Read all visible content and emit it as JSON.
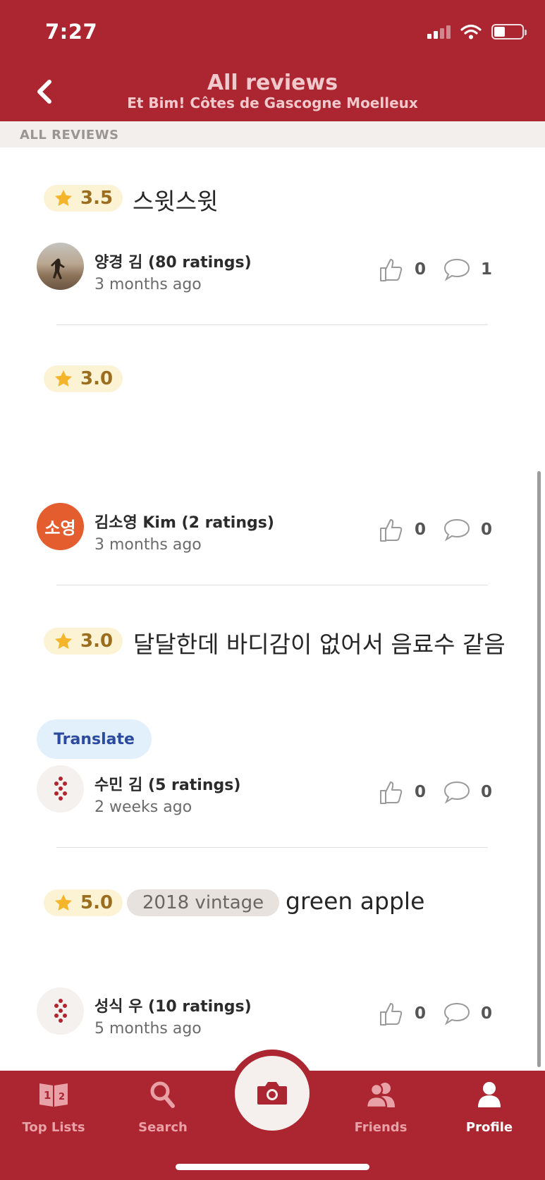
{
  "status_bar": {
    "time": "7:27"
  },
  "header": {
    "title": "All reviews",
    "subtitle": "Et Bim! Côtes de Gascogne Moelleux"
  },
  "section_label": "ALL REVIEWS",
  "reviews": [
    {
      "rating": "3.5",
      "text": "스윗스윗",
      "user": "양경 김 (80 ratings)",
      "time": "3 months ago",
      "likes": "0",
      "comments": "1"
    },
    {
      "rating": "3.0",
      "text": "",
      "user": "김소영 Kim (2 ratings)",
      "avatar_initials": "소영",
      "time": "3 months ago",
      "likes": "0",
      "comments": "0"
    },
    {
      "rating": "3.0",
      "text": "달달한데 바디감이 없어서 음료수 같음",
      "translate_label": "Translate",
      "user": "수민 김 (5 ratings)",
      "time": "2 weeks ago",
      "likes": "0",
      "comments": "0"
    },
    {
      "rating": "5.0",
      "vintage": "2018 vintage",
      "text": "green apple",
      "user": "성식 우 (10 ratings)",
      "time": "5 months ago",
      "likes": "0",
      "comments": "0"
    }
  ],
  "tabbar": {
    "tabs": [
      {
        "label": "Top Lists",
        "icon": "top-lists-icon"
      },
      {
        "label": "Search",
        "icon": "search-icon"
      },
      {
        "label": "Friends",
        "icon": "friends-icon"
      },
      {
        "label": "Profile",
        "icon": "profile-icon",
        "active": true
      }
    ],
    "center_icon": "camera-icon"
  },
  "colors": {
    "brand": "#ab2630",
    "rating_pill": "#fbf3d4",
    "star": "#f4b52b",
    "translate_bg": "#e2f0fb"
  }
}
